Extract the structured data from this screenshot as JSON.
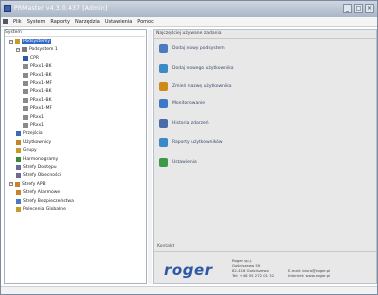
{
  "window": {
    "title": "PRMaster v4.3.0.437 [Admin]",
    "minimize_glyph": "_",
    "maximize_glyph": "□",
    "close_glyph": "×"
  },
  "menu": {
    "items": [
      "Plik",
      "System",
      "Raporty",
      "Narzędzia",
      "Ustawienia",
      "Pomoc"
    ]
  },
  "tree": {
    "header": "System",
    "rows": [
      {
        "label": "Podsystemy",
        "indent": 0,
        "icon": "folder-icon",
        "color": "#c89a2a",
        "expander": "−",
        "selected": true
      },
      {
        "label": "Podsystem 1",
        "indent": 1,
        "icon": "controller-icon",
        "color": "#7a7a7a",
        "expander": "−"
      },
      {
        "label": "CPR",
        "indent": 2,
        "icon": "cpr-icon",
        "color": "#2d58a6"
      },
      {
        "label": "PRxx1-BK",
        "indent": 2,
        "icon": "reader-icon",
        "color": "#8a8a8a"
      },
      {
        "label": "PRxx1-BK",
        "indent": 2,
        "icon": "reader-icon",
        "color": "#8a8a8a"
      },
      {
        "label": "PRxx1-MF",
        "indent": 2,
        "icon": "reader-icon",
        "color": "#8a8a8a"
      },
      {
        "label": "PRxx1-BK",
        "indent": 2,
        "icon": "reader-icon",
        "color": "#8a8a8a"
      },
      {
        "label": "PRxx1-BK",
        "indent": 2,
        "icon": "reader-icon",
        "color": "#8a8a8a"
      },
      {
        "label": "PRxx1-MF",
        "indent": 2,
        "icon": "reader-icon",
        "color": "#8a8a8a"
      },
      {
        "label": "PRxx1",
        "indent": 2,
        "icon": "reader-icon",
        "color": "#8a8a8a"
      },
      {
        "label": "PRxx1",
        "indent": 2,
        "icon": "reader-icon",
        "color": "#8a8a8a"
      },
      {
        "label": "Przejścia",
        "indent": 1,
        "icon": "door-icon",
        "color": "#3a6ab8"
      },
      {
        "label": "Użytkownicy",
        "indent": 1,
        "icon": "users-icon",
        "color": "#c8832a"
      },
      {
        "label": "Grupy",
        "indent": 1,
        "icon": "group-icon",
        "color": "#c89a2a"
      },
      {
        "label": "Harmonogramy",
        "indent": 1,
        "icon": "schedule-icon",
        "color": "#3a8a3a"
      },
      {
        "label": "Strefy Dostępu",
        "indent": 1,
        "icon": "zone-icon",
        "color": "#6a6a9a"
      },
      {
        "label": "Strefy Obecności",
        "indent": 1,
        "icon": "zone-icon",
        "color": "#6a6a9a"
      },
      {
        "label": "Strefy APB",
        "indent": 0,
        "icon": "apb-icon",
        "color": "#c8832a",
        "expander": "−"
      },
      {
        "label": "Strefy Alarmowe",
        "indent": 1,
        "icon": "alarm-icon",
        "color": "#c8832a"
      },
      {
        "label": "Strefy Bezpieczeństwa",
        "indent": 1,
        "icon": "security-icon",
        "color": "#4a7ac0"
      },
      {
        "label": "Polecenia Globalne",
        "indent": 1,
        "icon": "command-icon",
        "color": "#c89a2a"
      }
    ]
  },
  "panel": {
    "header": "Najczęściej używane zadania",
    "actions": [
      {
        "label": "Dodaj nowy podsystem",
        "icon": "add-subsystem-icon",
        "color": "#4a7ac0"
      },
      {
        "label": "Dodaj nowego użytkownika",
        "icon": "add-user-icon",
        "color": "#3a8ac8"
      },
      {
        "label": "Zmień nazwę użytkownika",
        "icon": "edit-icon",
        "color": "#d08a1a"
      },
      {
        "label": "Monitorowanie",
        "icon": "monitor-icon",
        "color": "#3a7ac8"
      },
      {
        "label": "Historia zdarzeń",
        "icon": "history-icon",
        "color": "#4a6aa8"
      },
      {
        "label": "Raporty użytkowników",
        "icon": "report-icon",
        "color": "#3a8ac8"
      },
      {
        "label": "Ustawienia",
        "icon": "settings-icon",
        "color": "#3a9a4a"
      }
    ],
    "footer_label": "Kontakt",
    "company": "roger",
    "contact_col1": [
      "Roger sp.j.",
      "Gościszewo 59",
      "82-416 Gościszewo",
      "Tel: +48 55 272 01 32"
    ],
    "contact_col2": [
      "",
      "",
      "E-mail: biuro@roger.pl",
      "Internet: www.roger.pl"
    ]
  },
  "status": {
    "text": ""
  }
}
